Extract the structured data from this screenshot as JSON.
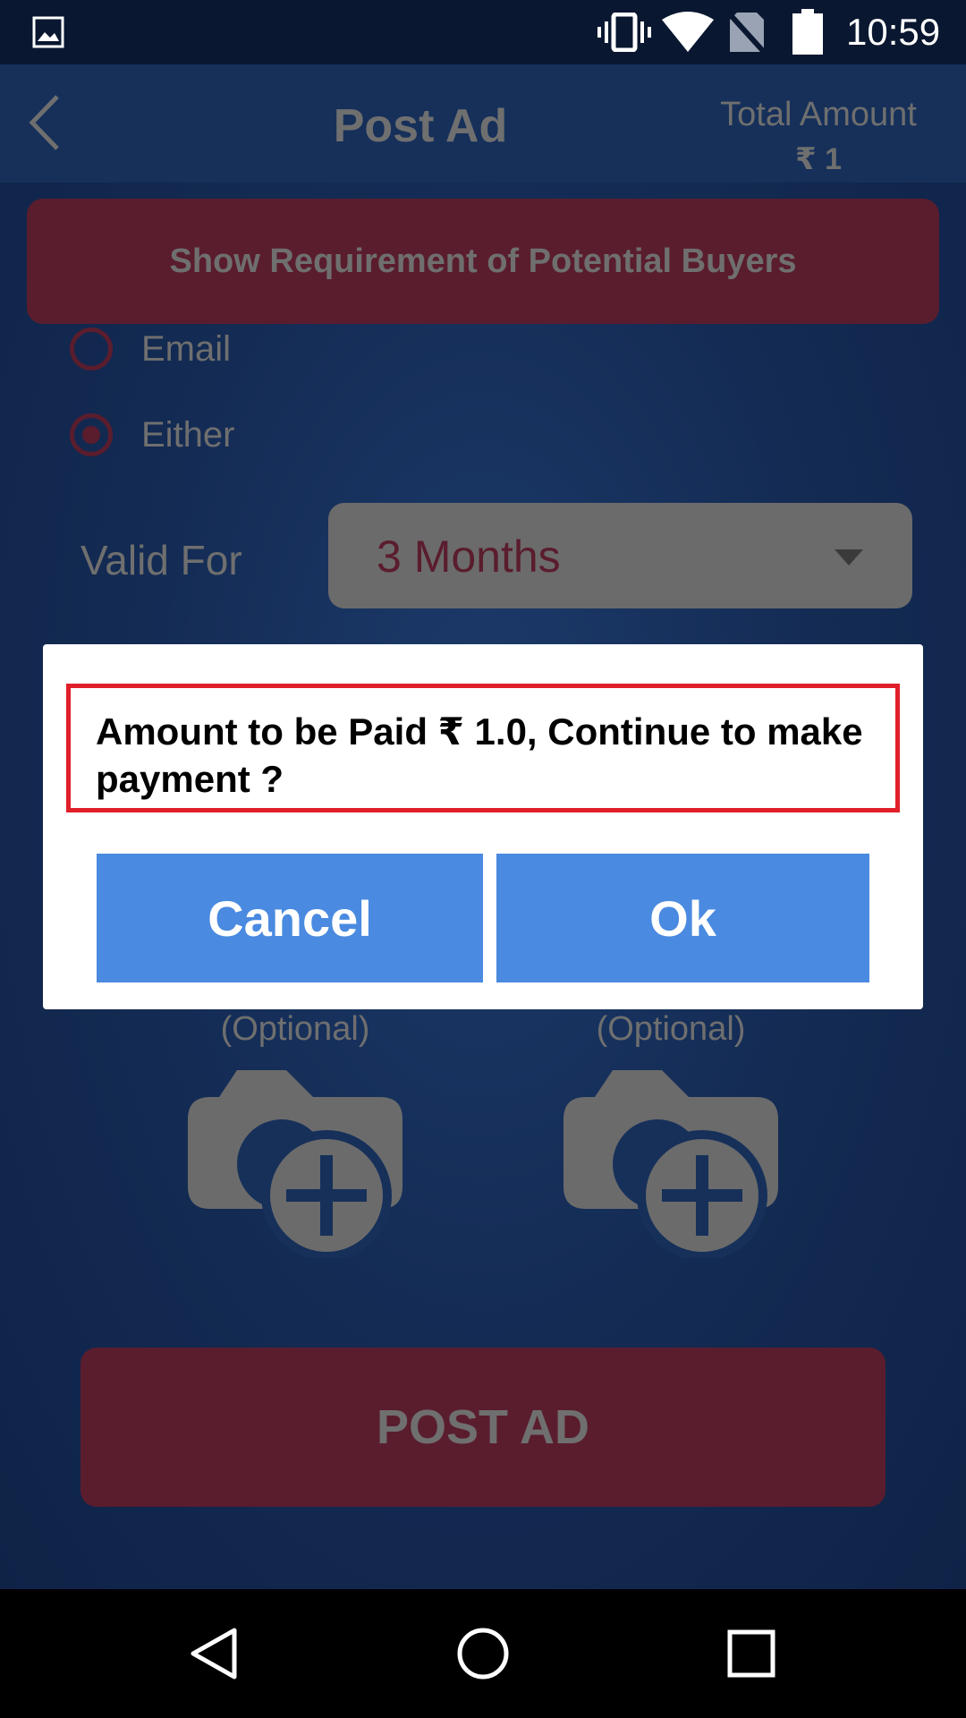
{
  "status_bar": {
    "time": "10:59",
    "icons": [
      "gallery-icon",
      "vibrate-icon",
      "wifi-icon",
      "no-sim-icon",
      "battery-icon"
    ]
  },
  "app_bar": {
    "title": "Post Ad",
    "total_label": "Total Amount",
    "total_value": "₹ 1"
  },
  "main": {
    "show_requirement_label": "Show Requirement of Potential Buyers",
    "contact_options": [
      {
        "label": "Email",
        "selected": false
      },
      {
        "label": "Either",
        "selected": true
      }
    ],
    "valid_for_label": "Valid For",
    "valid_for_value": "3 Months",
    "photo_slots": [
      {
        "label": "(Optional)"
      },
      {
        "label": "(Optional)"
      }
    ],
    "post_ad_label": "POST AD"
  },
  "dialog": {
    "message": "Amount to be Paid ₹ 1.0, Continue to make payment ?",
    "cancel_label": "Cancel",
    "ok_label": "Ok"
  },
  "colors": {
    "accent_button": "#4a8ae0",
    "highlight_border": "#e01f2a",
    "primary_dim": "#5a1d2e"
  }
}
